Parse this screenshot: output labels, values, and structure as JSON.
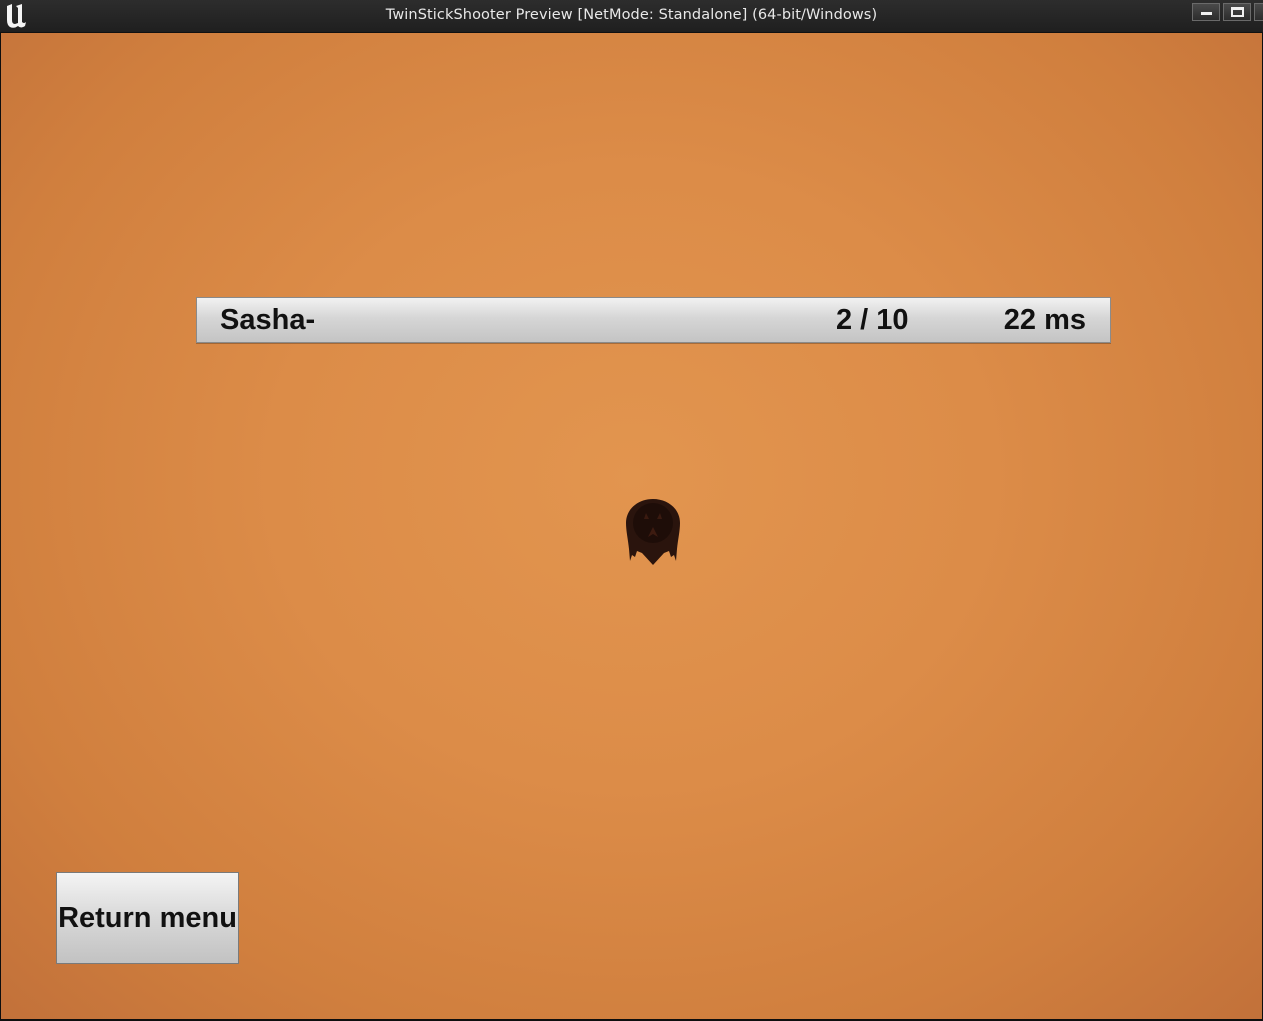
{
  "window": {
    "title": "TwinStickShooter Preview [NetMode: Standalone]  (64-bit/Windows)",
    "icons": {
      "logo": "unreal-logo-icon",
      "minimize": "minimize-icon",
      "maximize": "maximize-icon",
      "close": "close-icon"
    }
  },
  "scoreboard": {
    "rows": [
      {
        "name": "Sasha-",
        "score": "2 / 10",
        "ping": "22 ms"
      }
    ]
  },
  "game": {
    "player_ship_icon": "ship-icon"
  },
  "buttons": {
    "return_menu": "Return menu"
  },
  "colors": {
    "background_center": "#e2954f",
    "background_edge": "#c2713a",
    "titlebar": "#252525"
  }
}
